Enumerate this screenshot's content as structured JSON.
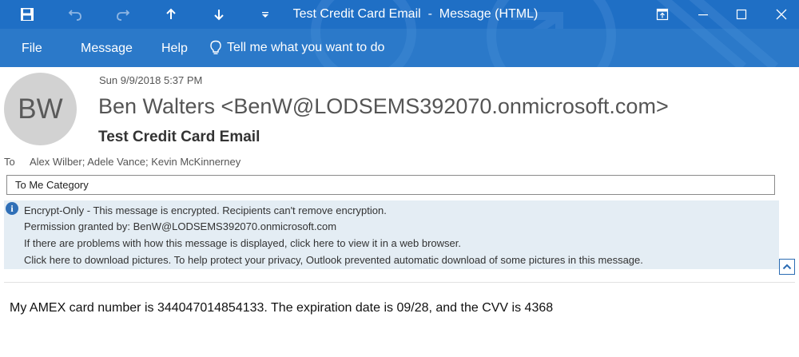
{
  "window": {
    "title": "Test Credit Card Email  -  Message (HTML)",
    "accent_color": "#1f6fc5",
    "quick_access": [
      "save-icon",
      "undo-icon",
      "redo-icon",
      "up-arrow-icon",
      "down-arrow-icon",
      "customize-dropdown-icon"
    ],
    "controls": [
      "restore-ribbon-icon",
      "minimize-icon",
      "maximize-icon",
      "close-icon"
    ]
  },
  "menu": {
    "items": [
      "File",
      "Message",
      "Help"
    ],
    "tell_me": "Tell me what you want to do",
    "tell_me_icon": "lightbulb-icon"
  },
  "message": {
    "avatar_initials": "BW",
    "sent": "Sun 9/9/2018 5:37 PM",
    "from": "Ben Walters <BenW@LODSEMS392070.onmicrosoft.com>",
    "subject": "Test Credit Card Email",
    "to_label": "To",
    "to": "Alex Wilber; Adele Vance; Kevin McKinnerney",
    "category": "To Me Category"
  },
  "infobar": {
    "icon": "info-icon",
    "lines": [
      "Encrypt-Only - This message is encrypted. Recipients can't remove encryption.",
      "Permission granted by: BenW@LODSEMS392070.onmicrosoft.com",
      "If there are problems with how this message is displayed, click here to view it in a web browser.",
      "Click here to download pictures. To help protect your privacy, Outlook prevented automatic download of some pictures in this message."
    ],
    "background": "#e4edf4"
  },
  "body": {
    "text": "My AMEX card number is 344047014854133. The expiration date is 09/28, and the CVV is 4368"
  }
}
